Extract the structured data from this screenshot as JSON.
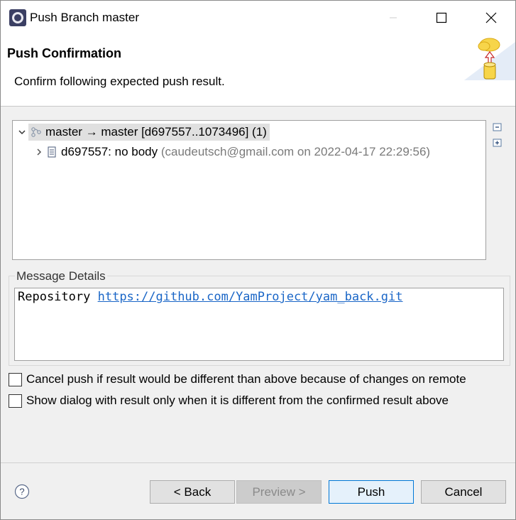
{
  "window": {
    "title": "Push Branch master"
  },
  "header": {
    "title": "Push Confirmation",
    "description": "Confirm following expected push result."
  },
  "tree": {
    "root": {
      "label": "master → master [d697557..1073496] (1)"
    },
    "child": {
      "label": "d697557: no body",
      "meta": "(caudeutsch@gmail.com on 2022-04-17 22:29:56)"
    }
  },
  "message": {
    "group_label": "Message Details",
    "prefix": "Repository",
    "link": "https://github.com/YamProject/yam_back.git"
  },
  "options": {
    "cancel_if_different": "Cancel push if result would be different than above because of changes on remote",
    "show_only_when_different": "Show dialog with result only when it is different from the confirmed result above"
  },
  "buttons": {
    "back": "< Back",
    "preview": "Preview >",
    "push": "Push",
    "cancel": "Cancel"
  },
  "icons": {
    "app": "eclipse-icon",
    "wizard": "cloud-push-icon",
    "branch": "branch-icon",
    "commit": "commit-icon",
    "collapse": "collapse-all-icon",
    "expand": "expand-all-icon",
    "help": "help-icon"
  }
}
